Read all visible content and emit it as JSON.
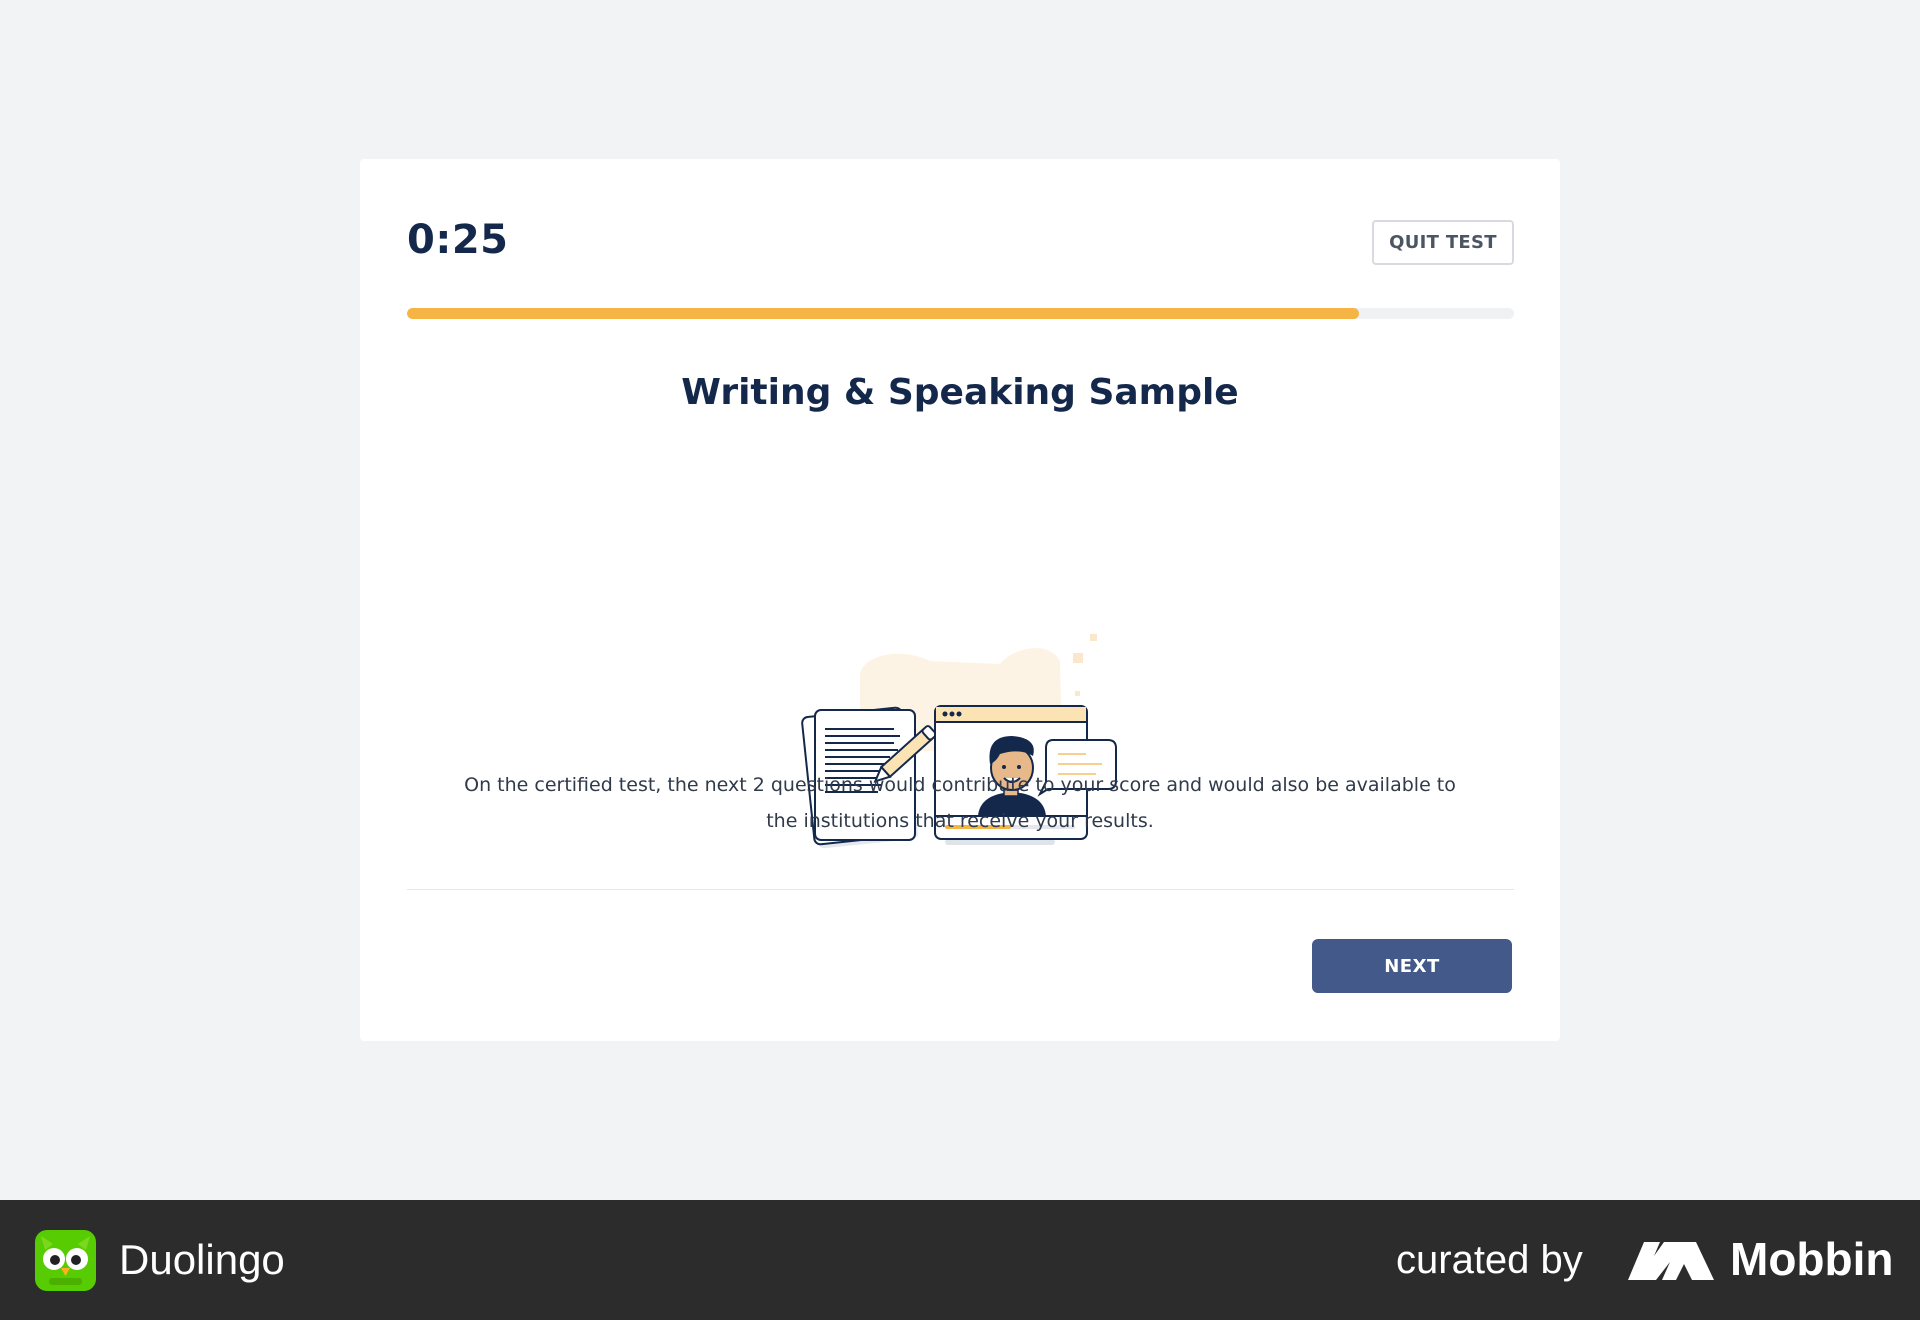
{
  "test": {
    "timer": "0:25",
    "quit_label": "QUIT TEST",
    "progress_fraction": 0.86,
    "title": "Writing & Speaking Sample",
    "description": "On the certified test, the next 2 questions would contribute to your score and would also be available to the institutions that receive your results.",
    "next_label": "NEXT"
  },
  "illustration": {
    "name": "writing-speaking-illustration",
    "icons": [
      "document-pencil-icon",
      "video-call-icon",
      "speech-bubble-icon"
    ]
  },
  "footer": {
    "app_name": "Duolingo",
    "curated_by": "curated by",
    "curator_name": "Mobbin",
    "logo_icon": "duolingo-owl-icon",
    "curator_icon": "mobbin-logo-icon"
  },
  "colors": {
    "background": "#f2f3f4",
    "card": "#ffffff",
    "text_primary": "#14284b",
    "progress": "#f5b443",
    "button_primary": "#43598a",
    "footer": "#2c2c2c",
    "duolingo_green": "#58cc02"
  }
}
